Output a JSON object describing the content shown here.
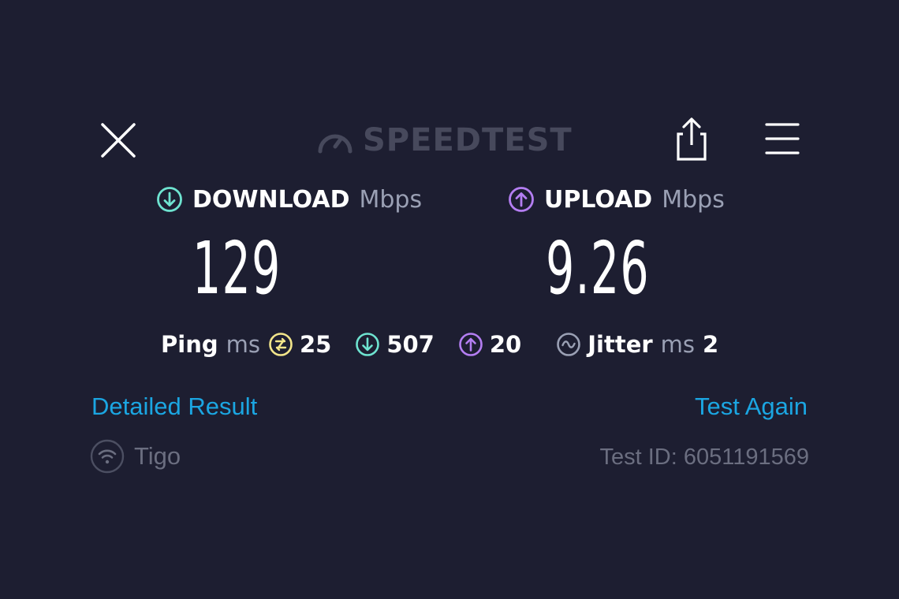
{
  "app": {
    "logo_text": "SPEEDTEST"
  },
  "header": {
    "close_icon": "close-icon",
    "share_icon": "share-icon",
    "menu_icon": "hamburger-menu-icon"
  },
  "download": {
    "label": "DOWNLOAD",
    "unit": "Mbps",
    "value": "129",
    "color": "#6ee3d0"
  },
  "upload": {
    "label": "UPLOAD",
    "unit": "Mbps",
    "value": "9.26",
    "color": "#b47ef2"
  },
  "ping": {
    "label": "Ping",
    "unit": "ms",
    "idle": "25",
    "idle_color": "#f2e58a",
    "download": "507",
    "upload": "20",
    "jitter_label": "Jitter",
    "jitter_unit": "ms",
    "jitter_value": "2"
  },
  "links": {
    "detailed": "Detailed Result",
    "test_again": "Test Again",
    "color": "#1ba6e2"
  },
  "footer": {
    "provider": "Tigo",
    "test_id": "Test ID: 6051191569"
  }
}
